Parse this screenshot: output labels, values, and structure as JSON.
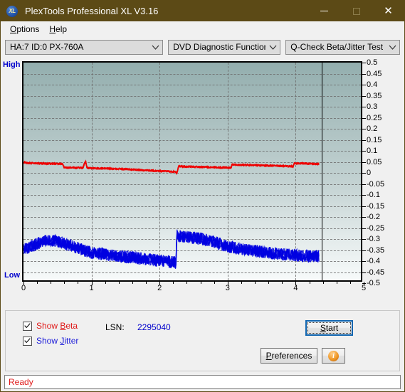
{
  "window": {
    "title": "PlexTools Professional XL V3.16",
    "icon": "xl-logo-icon",
    "minimize": "minimize-icon",
    "maximize": "maximize-icon",
    "close": "close-icon"
  },
  "menubar": {
    "items": [
      {
        "label": "Options",
        "accel": "O"
      },
      {
        "label": "Help",
        "accel": "H"
      }
    ]
  },
  "toolbar": {
    "drive_select": "HA:7 ID:0  PX-760A",
    "function_select": "DVD Diagnostic Functions",
    "test_select": "Q-Check Beta/Jitter Test",
    "chevron": "chevron-down-icon"
  },
  "controls": {
    "show_beta_label": "Show Beta",
    "show_beta_checked": true,
    "show_jitter_label": "Show Jitter",
    "show_jitter_checked": true,
    "lsn_label": "LSN:",
    "lsn_value": "2295040",
    "start_label": "Start",
    "preferences_label": "Preferences",
    "info_label": "i"
  },
  "statusbar": {
    "text": "Ready"
  },
  "colors": {
    "titlebar": "#5c4a16",
    "beta": "#ee0000",
    "jitter": "#0000e0",
    "accent_blue": "#0000cc",
    "status_red": "#e01b1b"
  },
  "chart_data": {
    "type": "line",
    "title": "",
    "xlabel": "",
    "ylabel": "",
    "xlim": [
      0,
      5
    ],
    "ylim": [
      -0.5,
      0.5
    ],
    "grid": true,
    "axis_left_label": "High",
    "axis_left_label_bottom": "Low",
    "xticks": [
      0,
      1,
      2,
      3,
      4,
      5
    ],
    "xtick_labels": [
      "0",
      "1",
      "2",
      "3",
      "4",
      "5"
    ],
    "yticks": [
      0.5,
      0.45,
      0.4,
      0.35,
      0.3,
      0.25,
      0.2,
      0.15,
      0.1,
      0.05,
      0,
      -0.05,
      -0.1,
      -0.15,
      -0.2,
      -0.25,
      -0.3,
      -0.35,
      -0.4,
      -0.45,
      -0.5
    ],
    "ytick_labels": [
      "0.5",
      "0.45",
      "0.4",
      "0.35",
      "0.3",
      "0.25",
      "0.2",
      "0.15",
      "0.1",
      "0.05",
      "0",
      "-0.05",
      "-0.1",
      "-0.15",
      "-0.2",
      "-0.25",
      "-0.3",
      "-0.35",
      "-0.4",
      "-0.45",
      "-0.5"
    ],
    "data_end_marker_x": 4.38,
    "series": [
      {
        "name": "Beta",
        "color": "#ee0000",
        "x": [
          0.0,
          0.04,
          0.08,
          0.12,
          0.18,
          0.24,
          0.3,
          0.36,
          0.42,
          0.48,
          0.54,
          0.58,
          0.6,
          0.64,
          0.7,
          0.76,
          0.82,
          0.88,
          0.92,
          0.94,
          0.96,
          1.0,
          1.06,
          1.12,
          1.18,
          1.24,
          1.3,
          1.36,
          1.42,
          1.48,
          1.54,
          1.6,
          1.66,
          1.72,
          1.78,
          1.84,
          1.9,
          1.96,
          2.02,
          2.08,
          2.14,
          2.2,
          2.26,
          2.27,
          2.3,
          2.36,
          2.42,
          2.48,
          2.54,
          2.6,
          2.66,
          2.72,
          2.78,
          2.84,
          2.9,
          2.96,
          3.02,
          3.08,
          3.09,
          3.14,
          3.2,
          3.26,
          3.32,
          3.38,
          3.44,
          3.5,
          3.56,
          3.62,
          3.68,
          3.74,
          3.8,
          3.86,
          3.92,
          3.96,
          4.0,
          4.01,
          4.06,
          4.12,
          4.18,
          4.24,
          4.3,
          4.36,
          4.38
        ],
        "y": [
          0.042,
          0.04,
          0.039,
          0.038,
          0.038,
          0.037,
          0.037,
          0.036,
          0.036,
          0.035,
          0.035,
          0.034,
          0.02,
          0.018,
          0.018,
          0.017,
          0.017,
          0.016,
          0.05,
          0.018,
          0.016,
          0.015,
          0.015,
          0.014,
          0.014,
          0.013,
          0.013,
          0.012,
          0.012,
          0.011,
          0.01,
          0.009,
          0.008,
          0.007,
          0.006,
          0.005,
          0.004,
          0.003,
          0.002,
          0.001,
          0.0,
          -0.001,
          -0.002,
          -0.012,
          0.024,
          0.023,
          0.022,
          0.022,
          0.021,
          0.021,
          0.02,
          0.02,
          0.019,
          0.019,
          0.018,
          0.018,
          0.017,
          0.017,
          0.032,
          0.031,
          0.031,
          0.03,
          0.03,
          0.029,
          0.029,
          0.028,
          0.028,
          0.027,
          0.027,
          0.026,
          0.026,
          0.025,
          0.024,
          0.024,
          0.023,
          0.038,
          0.037,
          0.037,
          0.036,
          0.036,
          0.035,
          0.035,
          0.034
        ],
        "noise": 0.004
      },
      {
        "name": "Jitter",
        "color": "#0000e0",
        "x": [
          0.0,
          0.05,
          0.1,
          0.15,
          0.2,
          0.25,
          0.3,
          0.35,
          0.4,
          0.45,
          0.5,
          0.55,
          0.6,
          0.65,
          0.7,
          0.75,
          0.8,
          0.85,
          0.9,
          0.95,
          1.0,
          1.1,
          1.2,
          1.3,
          1.4,
          1.5,
          1.6,
          1.7,
          1.8,
          1.9,
          2.0,
          2.1,
          2.2,
          2.26,
          2.27,
          2.32,
          2.4,
          2.48,
          2.56,
          2.64,
          2.72,
          2.8,
          2.88,
          2.96,
          3.04,
          3.06,
          3.12,
          3.2,
          3.3,
          3.4,
          3.5,
          3.6,
          3.7,
          3.8,
          3.9,
          4.0,
          4.1,
          4.2,
          4.3,
          4.38
        ],
        "y": [
          -0.36,
          -0.352,
          -0.344,
          -0.338,
          -0.332,
          -0.326,
          -0.32,
          -0.318,
          -0.316,
          -0.318,
          -0.32,
          -0.326,
          -0.332,
          -0.336,
          -0.34,
          -0.344,
          -0.352,
          -0.358,
          -0.364,
          -0.368,
          -0.372,
          -0.376,
          -0.38,
          -0.384,
          -0.388,
          -0.392,
          -0.394,
          -0.398,
          -0.402,
          -0.406,
          -0.408,
          -0.412,
          -0.416,
          -0.42,
          -0.294,
          -0.296,
          -0.3,
          -0.304,
          -0.306,
          -0.31,
          -0.316,
          -0.322,
          -0.33,
          -0.338,
          -0.348,
          -0.344,
          -0.35,
          -0.356,
          -0.36,
          -0.364,
          -0.368,
          -0.372,
          -0.376,
          -0.38,
          -0.382,
          -0.384,
          -0.386,
          -0.388,
          -0.39,
          -0.392
        ],
        "noise": 0.028
      }
    ]
  }
}
